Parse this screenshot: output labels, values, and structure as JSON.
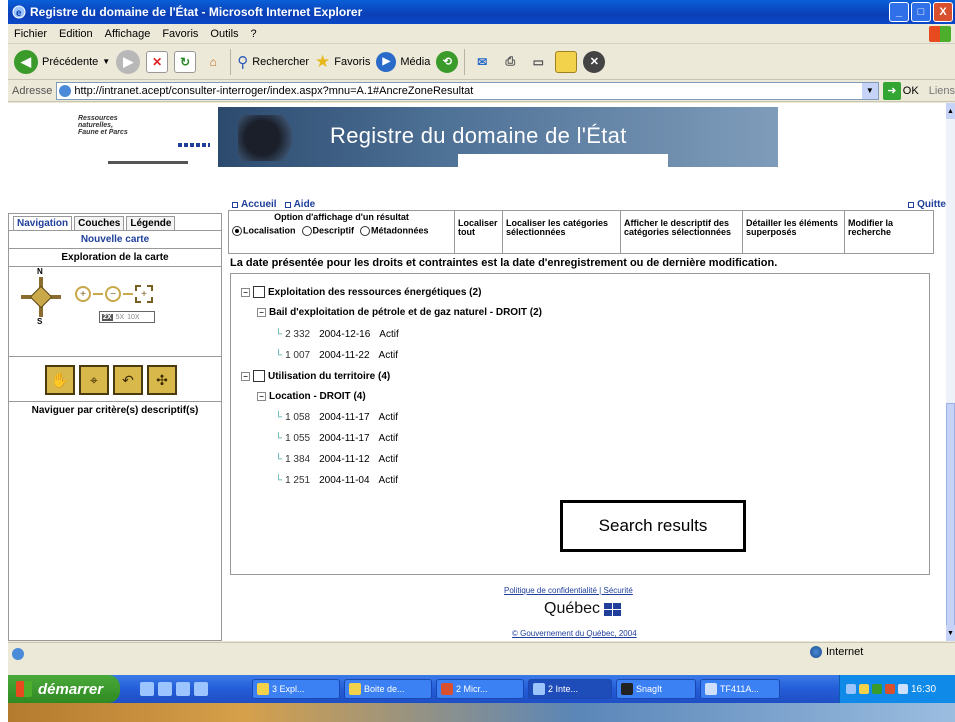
{
  "window": {
    "title": "Registre du domaine de l'État - Microsoft Internet Explorer",
    "min_label": "_",
    "max_label": "□",
    "close_label": "X"
  },
  "menu": [
    "Fichier",
    "Edition",
    "Affichage",
    "Favoris",
    "Outils",
    "?"
  ],
  "toolbar": {
    "back_label": "Précédente",
    "search_label": "Rechercher",
    "favorites_label": "Favoris",
    "media_label": "Média"
  },
  "address": {
    "label": "Adresse",
    "url": "http://intranet.acept/consulter-interroger/index.aspx?mnu=A.1#AncreZoneResultat",
    "go_label": "OK",
    "links_label": "Liens"
  },
  "header": {
    "ministry_line1": "Ressources",
    "ministry_line2": "naturelles,",
    "ministry_line3": "Faune et Parcs",
    "banner_title": "Registre du domaine de l'État",
    "link_home": "Accueil",
    "link_help": "Aide",
    "link_quit": "Quitte"
  },
  "left_panel": {
    "tabs": [
      "Navigation",
      "Couches",
      "Légende"
    ],
    "new_map": "Nouvelle carte",
    "explore_title": "Exploration de la carte",
    "compass_n": "N",
    "compass_s": "S",
    "scale_2x": "2X",
    "scale_5x": "5X",
    "scale_10x": "10X",
    "descriptive_nav": "Naviguer par critère(s) descriptif(s)"
  },
  "options": {
    "display_title": "Option d'affichage d'un résultat",
    "radio_localisation": "Localisation",
    "radio_descriptif": "Descriptif",
    "radio_metadonnees": "Métadonnées",
    "selected": "Localisation",
    "col_localiser_tout": "Localiser tout",
    "col_localiser_cat": "Localiser les catégories sélectionnées",
    "col_afficher": "Afficher le descriptif des catégories sélectionnées",
    "col_detailler": "Détailler les éléments superposés",
    "col_modifier": "Modifier la recherche"
  },
  "notice": "La date présentée pour les droits et contraintes est la date d'enregistrement ou de dernière modification.",
  "tree": {
    "group1": "Exploitation des ressources énergétiques (2)",
    "group1_sub": "Bail d'exploitation de pétrole et de gaz naturel - DROIT (2)",
    "group1_items": [
      {
        "num": "2 332",
        "date": "2004-12-16",
        "status": "Actif"
      },
      {
        "num": "1 007",
        "date": "2004-11-22",
        "status": "Actif"
      }
    ],
    "group2": "Utilisation du territoire (4)",
    "group2_sub": "Location - DROIT (4)",
    "group2_items": [
      {
        "num": "1 058",
        "date": "2004-11-17",
        "status": "Actif"
      },
      {
        "num": "1 055",
        "date": "2004-11-17",
        "status": "Actif"
      },
      {
        "num": "1 384",
        "date": "2004-11-12",
        "status": "Actif"
      },
      {
        "num": "1 251",
        "date": "2004-11-04",
        "status": "Actif"
      }
    ]
  },
  "callout": "Search results",
  "footer": {
    "links": "Politique de confidentialité | Sécurité",
    "quebec": "Québec",
    "copyright": "© Gouvernement du Québec, 2004"
  },
  "status": {
    "zone": "Internet"
  },
  "taskbar": {
    "start_label": "démarrer",
    "tasks": [
      "3 Expl...",
      "Boite de...",
      "2 Micr...",
      "2 Inte...",
      "SnagIt",
      "TF411A..."
    ],
    "clock": "16:30"
  }
}
